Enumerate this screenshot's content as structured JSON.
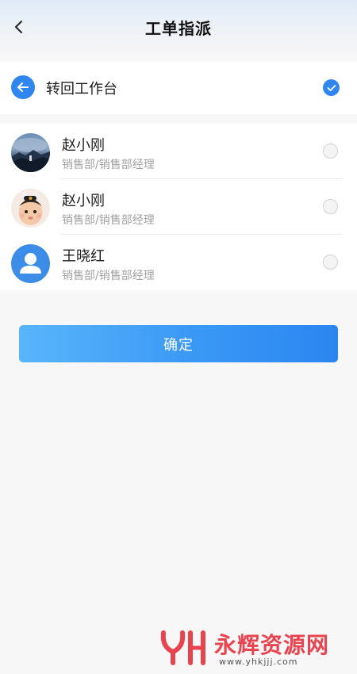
{
  "header": {
    "title": "工单指派",
    "back_icon": "chevron-left-icon"
  },
  "return_option": {
    "label": "转回工作台",
    "icon": "arrow-left-icon",
    "selected": true
  },
  "assignees": [
    {
      "name": "赵小刚",
      "dept": "销售部/销售部经理",
      "avatar": "landscape-photo",
      "selected": false
    },
    {
      "name": "赵小刚",
      "dept": "销售部/销售部经理",
      "avatar": "baby-photo",
      "selected": false
    },
    {
      "name": "王晓红",
      "dept": "销售部/销售部经理",
      "avatar": "default-user-icon",
      "selected": false
    }
  ],
  "confirm_button": {
    "label": "确定"
  },
  "watermark": {
    "title": "永辉资源网",
    "url": "www.yhkjjj.com"
  },
  "colors": {
    "accent": "#2f86ee",
    "button_gradient_start": "#58b5fb",
    "button_gradient_end": "#2b86f1",
    "watermark": "#e8444f"
  }
}
